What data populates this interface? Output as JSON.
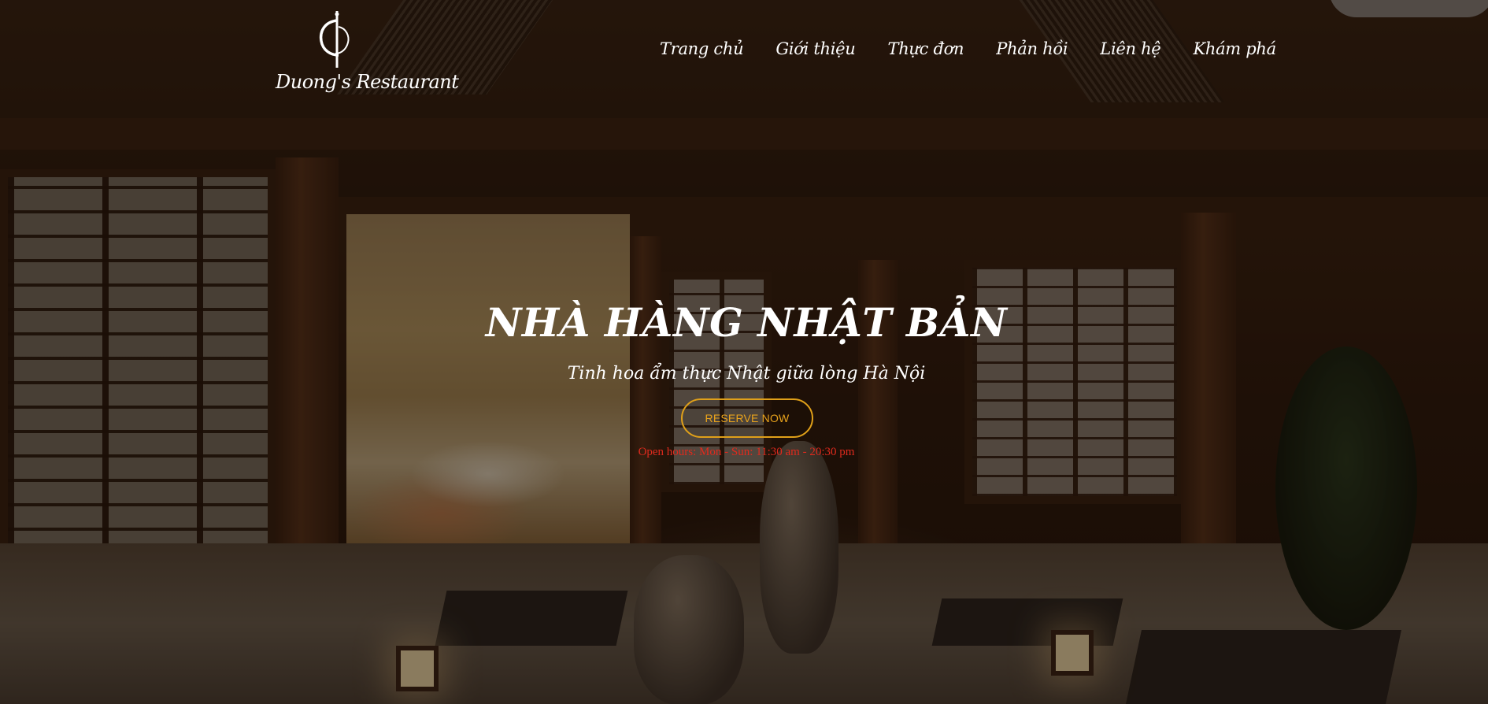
{
  "logo": {
    "text": "Duong's Restaurant",
    "icon": "restaurant-monogram-icon"
  },
  "nav": {
    "items": [
      {
        "label": "Trang chủ"
      },
      {
        "label": "Giới thiệu"
      },
      {
        "label": "Thực đơn"
      },
      {
        "label": "Phản hồi"
      },
      {
        "label": "Liên hệ"
      },
      {
        "label": "Khám phá"
      }
    ]
  },
  "hero": {
    "title": "NHÀ HÀNG NHẬT BẢN",
    "subtitle": "Tinh hoa ẩm thực Nhật giữa lòng Hà Nội",
    "cta_label": "RESERVE NOW",
    "hours": "Open hours: Mon - Sun: 11:30 am - 20:30 pm",
    "background": "japanese-restaurant-interior-photo"
  },
  "colors": {
    "cta_accent": "#e0a019",
    "hours_text": "#e02a1d",
    "nav_text": "#ffffff"
  }
}
